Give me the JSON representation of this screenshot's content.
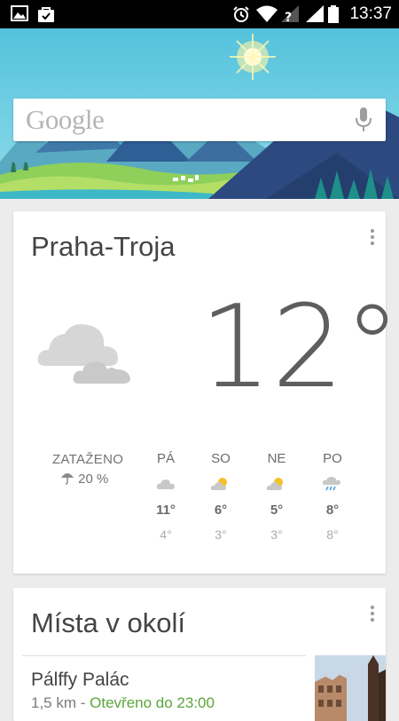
{
  "status_bar": {
    "time": "13:37",
    "icons": [
      "image-icon",
      "shopping-bag-icon",
      "alarm-icon",
      "wifi-icon",
      "signal-no-sim-icon",
      "signal-icon",
      "battery-icon"
    ]
  },
  "header": {
    "search_logo": "Google",
    "colors": {
      "sky": "#58c8df",
      "mountain": "#2f4a7d",
      "grass": "#a7d65b"
    }
  },
  "weather": {
    "location": "Praha-Troja",
    "temperature": "12°",
    "condition": "ZATAŽENO",
    "precipitation": "20 %",
    "forecast": [
      {
        "day": "PÁ",
        "icon": "cloudy-icon",
        "high": "11°",
        "low": "4°"
      },
      {
        "day": "SO",
        "icon": "partly-sunny-icon",
        "high": "6°",
        "low": "3°"
      },
      {
        "day": "NE",
        "icon": "partly-sunny-icon",
        "high": "5°",
        "low": "3°"
      },
      {
        "day": "PO",
        "icon": "rain-icon",
        "high": "8°",
        "low": "8°"
      }
    ]
  },
  "places": {
    "title": "Místa v okolí",
    "items": [
      {
        "name": "Pálffy Palác",
        "distance": "1,5 km",
        "separator": " - ",
        "status": "Otevřeno do 23:00"
      }
    ]
  }
}
